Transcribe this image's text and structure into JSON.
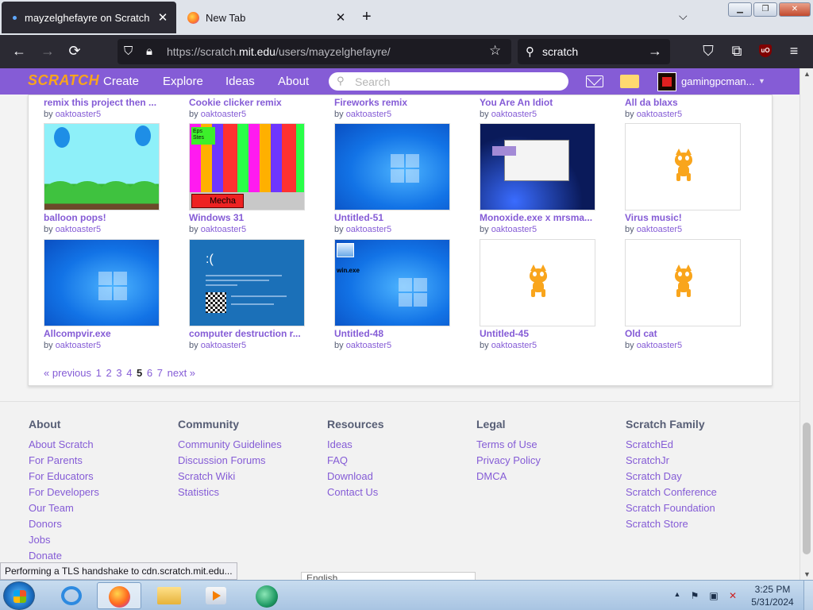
{
  "browser": {
    "tabs": [
      {
        "title": "mayzelghefayre on Scratch",
        "active": true
      },
      {
        "title": "New Tab",
        "active": false
      }
    ],
    "url_prefix": "https://scratch.",
    "url_domain": "mit.edu",
    "url_path": "/users/mayzelghefayre/",
    "search_value": "scratch",
    "status_text": "Performing a TLS handshake to cdn.scratch.mit.edu..."
  },
  "scratch_nav": {
    "logo": "SCRATCH",
    "items": [
      "Create",
      "Explore",
      "Ideas",
      "About"
    ],
    "search_placeholder": "Search",
    "username": "gamingpcman..."
  },
  "projects": {
    "top_row": [
      {
        "title": "remix this project then ...",
        "author": "oaktoaster5"
      },
      {
        "title": "Cookie clicker remix",
        "author": "oaktoaster5"
      },
      {
        "title": "Fireworks remix",
        "author": "oaktoaster5"
      },
      {
        "title": "You Are An Idiot",
        "author": "oaktoaster5"
      },
      {
        "title": "All da blaxs",
        "author": "oaktoaster5"
      }
    ],
    "row2": [
      {
        "title": "balloon pops!",
        "author": "oaktoaster5"
      },
      {
        "title": "Windows 31",
        "author": "oaktoaster5",
        "thumb_text_1": "Eps Stes",
        "thumb_text_2": "Mecha"
      },
      {
        "title": "Untitled-51",
        "author": "oaktoaster5"
      },
      {
        "title": "Monoxide.exe x mrsma...",
        "author": "oaktoaster5"
      },
      {
        "title": "Virus music!",
        "author": "oaktoaster5"
      }
    ],
    "row3": [
      {
        "title": "Allcompvir.exe",
        "author": "oaktoaster5"
      },
      {
        "title": "computer destruction r...",
        "author": "oaktoaster5",
        "thumb_text_1": ":("
      },
      {
        "title": "Untitled-48",
        "author": "oaktoaster5",
        "thumb_text_1": "win.exe"
      },
      {
        "title": "Untitled-45",
        "author": "oaktoaster5"
      },
      {
        "title": "Old cat",
        "author": "oaktoaster5"
      }
    ],
    "by_label": "by"
  },
  "pagination": {
    "previous": "« previous",
    "pages": [
      "1",
      "2",
      "3",
      "4",
      "5",
      "6",
      "7"
    ],
    "current": "5",
    "next": "next »"
  },
  "footer": {
    "columns": [
      {
        "heading": "About",
        "links": [
          "About Scratch",
          "For Parents",
          "For Educators",
          "For Developers",
          "Our Team",
          "Donors",
          "Jobs",
          "Donate"
        ]
      },
      {
        "heading": "Community",
        "links": [
          "Community Guidelines",
          "Discussion Forums",
          "Scratch Wiki",
          "Statistics"
        ]
      },
      {
        "heading": "Resources",
        "links": [
          "Ideas",
          "FAQ",
          "Download",
          "Contact Us"
        ]
      },
      {
        "heading": "Legal",
        "links": [
          "Terms of Use",
          "Privacy Policy",
          "DMCA"
        ]
      },
      {
        "heading": "Scratch Family",
        "links": [
          "ScratchEd",
          "ScratchJr",
          "Scratch Day",
          "Scratch Conference",
          "Scratch Foundation",
          "Scratch Store"
        ]
      }
    ],
    "language": "English"
  },
  "taskbar": {
    "time": "3:25 PM",
    "date": "5/31/2024"
  },
  "colors": {
    "scratch_purple": "#855cd6",
    "firefox_dark": "#2b2a33"
  }
}
